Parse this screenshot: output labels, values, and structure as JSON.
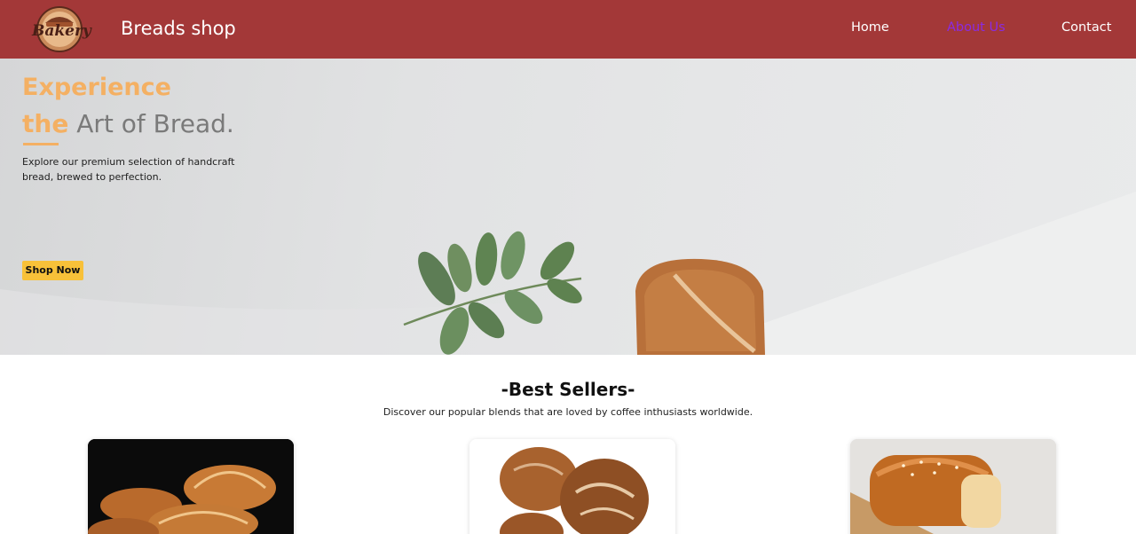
{
  "header": {
    "logo_text": "Bakery",
    "brand": "Breads shop",
    "nav": {
      "home": "Home",
      "about": "About Us",
      "contact": "Contact"
    },
    "colors": {
      "bar": "#a33838",
      "active_link": "#8a2be2"
    }
  },
  "hero": {
    "title_line1": "Experience",
    "title_accent": "the",
    "title_rest": " Art of Bread.",
    "description": "Explore our premium selection of handcraft bread, brewed to perfection.",
    "cta_label": "Shop Now",
    "colors": {
      "accent": "#f4b063",
      "button": "#f8c139"
    }
  },
  "best_sellers": {
    "title_prefix": "-Best ",
    "title_strong": "Sellers",
    "title_suffix": "-",
    "subtitle": "Discover our popular blends that are loved by coffee inthusiasts worldwide.",
    "products": [
      {
        "image": "croissants-image"
      },
      {
        "image": "sourdough-loaves-image"
      },
      {
        "image": "brioche-loaf-image"
      }
    ]
  }
}
